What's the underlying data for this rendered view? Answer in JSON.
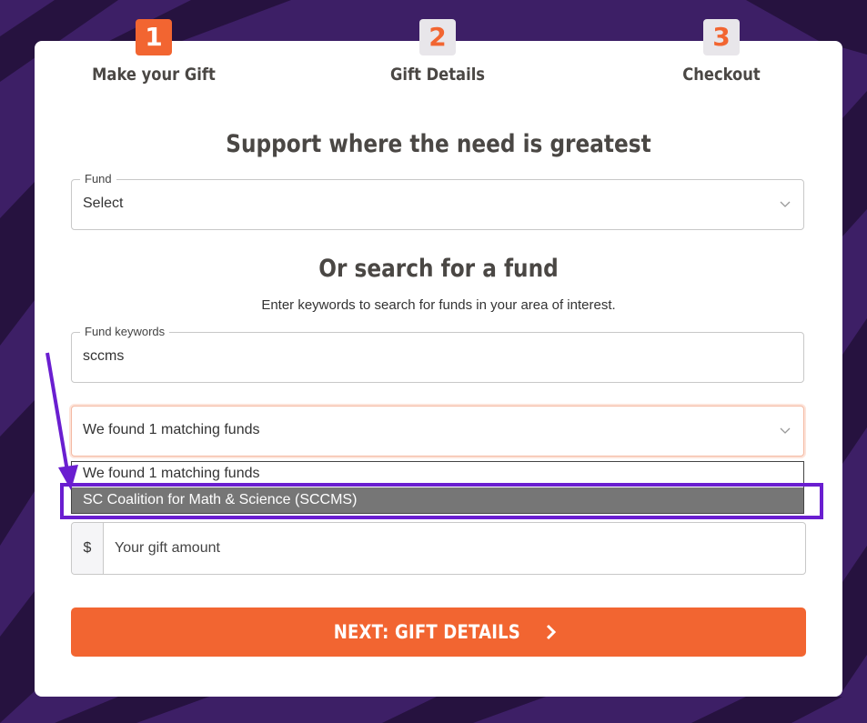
{
  "steps": [
    {
      "number": "1",
      "label": "Make your Gift"
    },
    {
      "number": "2",
      "label": "Gift Details"
    },
    {
      "number": "3",
      "label": "Checkout"
    }
  ],
  "main_heading": "Support where the need is greatest",
  "fund_select": {
    "label": "Fund",
    "value": "Select"
  },
  "search_heading": "Or search for a fund",
  "search_help": "Enter keywords to search for funds in your area of interest.",
  "keywords_field": {
    "label": "Fund keywords",
    "value": "sccms"
  },
  "results_select": {
    "value": "We found 1 matching funds",
    "options": [
      "We found 1 matching funds",
      "SC Coalition for Math & Science (SCCMS)"
    ]
  },
  "gift_amount": {
    "prefix": "$",
    "placeholder": "Your gift amount"
  },
  "next_button": {
    "label": "NEXT: GIFT DETAILS"
  },
  "colors": {
    "accent": "#f26531",
    "annotation": "#6a1ed0",
    "background": "#3d1f66"
  }
}
